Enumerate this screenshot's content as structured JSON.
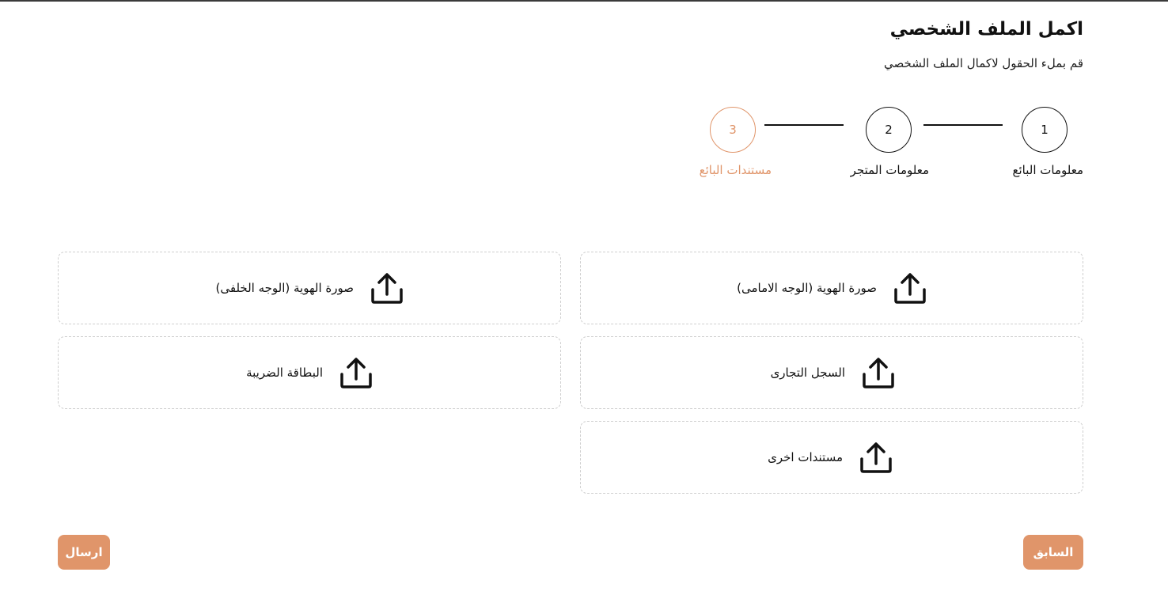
{
  "header": {
    "title": "اكمل الملف الشخصي",
    "subtitle": "قم بملء الحقول لاكمال الملف الشخصي"
  },
  "stepper": {
    "steps": [
      {
        "number": "1",
        "label": "معلومات البائع",
        "active": false
      },
      {
        "number": "2",
        "label": "معلومات المتجر",
        "active": false
      },
      {
        "number": "3",
        "label": "مستندات البائع",
        "active": true
      }
    ]
  },
  "uploads": {
    "id_front": {
      "label": "صورة الهوية (الوجه الامامى)",
      "icon": "upload-icon"
    },
    "id_back": {
      "label": "صورة الهوية (الوجه الخلفى)",
      "icon": "upload-icon"
    },
    "commercial_register": {
      "label": "السجل التجارى",
      "icon": "upload-icon"
    },
    "tax_card": {
      "label": "البطاقة الضريبة",
      "icon": "upload-icon"
    },
    "other_documents": {
      "label": "مستندات اخرى",
      "icon": "upload-icon"
    }
  },
  "actions": {
    "previous_label": "السابق",
    "submit_label": "ارسال"
  },
  "colors": {
    "accent": "#e0956a",
    "text": "#111111",
    "card_border": "#cfcfcf"
  }
}
